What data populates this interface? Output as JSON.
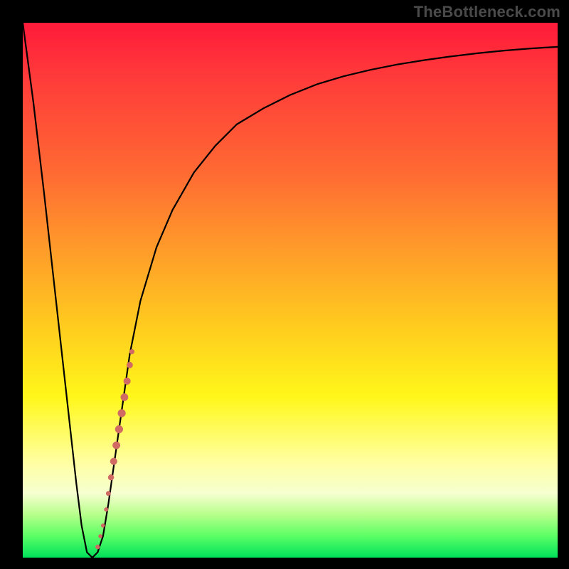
{
  "watermark": "TheBottleneck.com",
  "colors": {
    "frame_bg": "#000000",
    "curve": "#000000",
    "dots": "#d06a63",
    "gradient_stops": [
      "#ff1a3a",
      "#ff3a3a",
      "#ff6a33",
      "#ff9a2a",
      "#ffc91f",
      "#fff71a",
      "#ffffa0",
      "#f6ffd0",
      "#b6ff8a",
      "#5aff66",
      "#00e05a"
    ]
  },
  "chart_data": {
    "type": "line",
    "title": "",
    "xlabel": "",
    "ylabel": "",
    "xlim": [
      0,
      100
    ],
    "ylim": [
      0,
      100
    ],
    "grid": false,
    "legend": false,
    "series": [
      {
        "name": "curve",
        "x": [
          0,
          2,
          4,
          6,
          8,
          10,
          11,
          12,
          13,
          14,
          15,
          16,
          18,
          20,
          22,
          25,
          28,
          32,
          36,
          40,
          45,
          50,
          55,
          60,
          65,
          70,
          75,
          80,
          85,
          90,
          95,
          100
        ],
        "y": [
          100,
          85,
          68,
          50,
          32,
          14,
          6,
          1,
          0,
          1,
          4,
          10,
          24,
          38,
          48,
          58,
          65,
          72,
          77,
          81,
          84,
          86.5,
          88.5,
          90,
          91.2,
          92.2,
          93,
          93.7,
          94.3,
          94.8,
          95.2,
          95.5
        ]
      }
    ],
    "points": {
      "name": "dots",
      "data": [
        {
          "x": 14.0,
          "y": 2.0,
          "r": 3.0
        },
        {
          "x": 14.5,
          "y": 4.0,
          "r": 2.6
        },
        {
          "x": 15.0,
          "y": 6.0,
          "r": 2.6
        },
        {
          "x": 15.6,
          "y": 9.0,
          "r": 2.8
        },
        {
          "x": 16.0,
          "y": 12.0,
          "r": 3.2
        },
        {
          "x": 16.5,
          "y": 15.0,
          "r": 4.0
        },
        {
          "x": 17.0,
          "y": 18.0,
          "r": 4.8
        },
        {
          "x": 17.5,
          "y": 21.0,
          "r": 5.2
        },
        {
          "x": 18.0,
          "y": 24.0,
          "r": 5.4
        },
        {
          "x": 18.5,
          "y": 27.0,
          "r": 5.4
        },
        {
          "x": 19.0,
          "y": 30.0,
          "r": 5.2
        },
        {
          "x": 19.5,
          "y": 33.0,
          "r": 4.8
        },
        {
          "x": 20.0,
          "y": 36.0,
          "r": 4.2
        },
        {
          "x": 20.4,
          "y": 38.5,
          "r": 3.4
        }
      ]
    }
  }
}
